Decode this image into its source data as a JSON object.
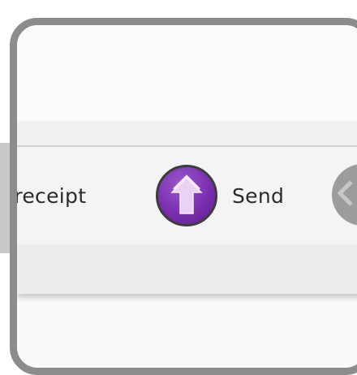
{
  "actions": {
    "receipt_label": "t receipt",
    "send_label": "Send"
  },
  "icons": {
    "send": "up-arrow-icon",
    "next": "chevron-left-icon"
  },
  "colors": {
    "send_accent": "#7a2fb0",
    "frame": "#8c8c8c"
  }
}
